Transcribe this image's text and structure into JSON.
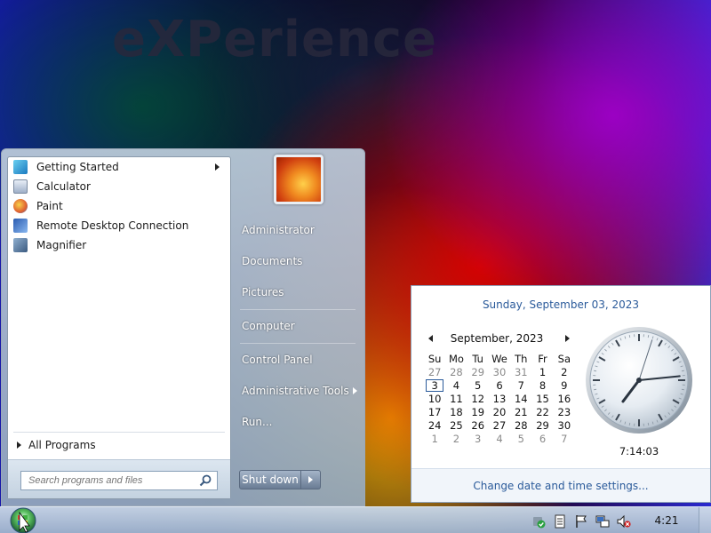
{
  "wallpaper": {
    "title": "eXPerience"
  },
  "start_menu": {
    "programs": [
      {
        "label": "Getting Started",
        "icon": "getting-started-icon",
        "has_submenu": true
      },
      {
        "label": "Calculator",
        "icon": "calculator-icon",
        "has_submenu": false
      },
      {
        "label": "Paint",
        "icon": "paint-icon",
        "has_submenu": false
      },
      {
        "label": "Remote Desktop Connection",
        "icon": "remote-desktop-icon",
        "has_submenu": false
      },
      {
        "label": "Magnifier",
        "icon": "magnifier-icon",
        "has_submenu": false
      }
    ],
    "all_programs_label": "All Programs",
    "search_placeholder": "Search programs and files",
    "right_items": [
      {
        "label": "Administrator",
        "has_submenu": false
      },
      {
        "label": "Documents",
        "has_submenu": false
      },
      {
        "label": "Pictures",
        "has_submenu": false
      },
      {
        "label": "Computer",
        "has_submenu": false
      },
      {
        "label": "Control Panel",
        "has_submenu": false
      },
      {
        "label": "Administrative Tools",
        "has_submenu": true
      },
      {
        "label": "Run...",
        "has_submenu": false
      }
    ],
    "shutdown_label": "Shut down"
  },
  "calendar": {
    "date_header": "Sunday, September 03, 2023",
    "month_label": "September, 2023",
    "weekdays": [
      "Su",
      "Mo",
      "Tu",
      "We",
      "Th",
      "Fr",
      "Sa"
    ],
    "weeks": [
      [
        {
          "d": "27",
          "o": true
        },
        {
          "d": "28",
          "o": true
        },
        {
          "d": "29",
          "o": true
        },
        {
          "d": "30",
          "o": true
        },
        {
          "d": "31",
          "o": true
        },
        {
          "d": "1"
        },
        {
          "d": "2"
        }
      ],
      [
        {
          "d": "3",
          "t": true
        },
        {
          "d": "4"
        },
        {
          "d": "5"
        },
        {
          "d": "6"
        },
        {
          "d": "7"
        },
        {
          "d": "8"
        },
        {
          "d": "9"
        }
      ],
      [
        {
          "d": "10"
        },
        {
          "d": "11"
        },
        {
          "d": "12"
        },
        {
          "d": "13"
        },
        {
          "d": "14"
        },
        {
          "d": "15"
        },
        {
          "d": "16"
        }
      ],
      [
        {
          "d": "17"
        },
        {
          "d": "18"
        },
        {
          "d": "19"
        },
        {
          "d": "20"
        },
        {
          "d": "21"
        },
        {
          "d": "22"
        },
        {
          "d": "23"
        }
      ],
      [
        {
          "d": "24"
        },
        {
          "d": "25"
        },
        {
          "d": "26"
        },
        {
          "d": "27"
        },
        {
          "d": "28"
        },
        {
          "d": "29"
        },
        {
          "d": "30"
        }
      ],
      [
        {
          "d": "1",
          "o": true
        },
        {
          "d": "2",
          "o": true
        },
        {
          "d": "3",
          "o": true
        },
        {
          "d": "4",
          "o": true
        },
        {
          "d": "5",
          "o": true
        },
        {
          "d": "6",
          "o": true
        },
        {
          "d": "7",
          "o": true
        }
      ]
    ],
    "clock_time": "7:14:03",
    "clock_hours": 7,
    "clock_minutes": 14,
    "clock_seconds": 3,
    "footer_link": "Change date and time settings..."
  },
  "taskbar": {
    "clock": "4:21",
    "tray_icons": [
      "shield-check-icon",
      "document-icon",
      "flag-icon",
      "network-icon",
      "volume-muted-icon"
    ]
  },
  "colors": {
    "link_blue": "#2a5a9a"
  }
}
